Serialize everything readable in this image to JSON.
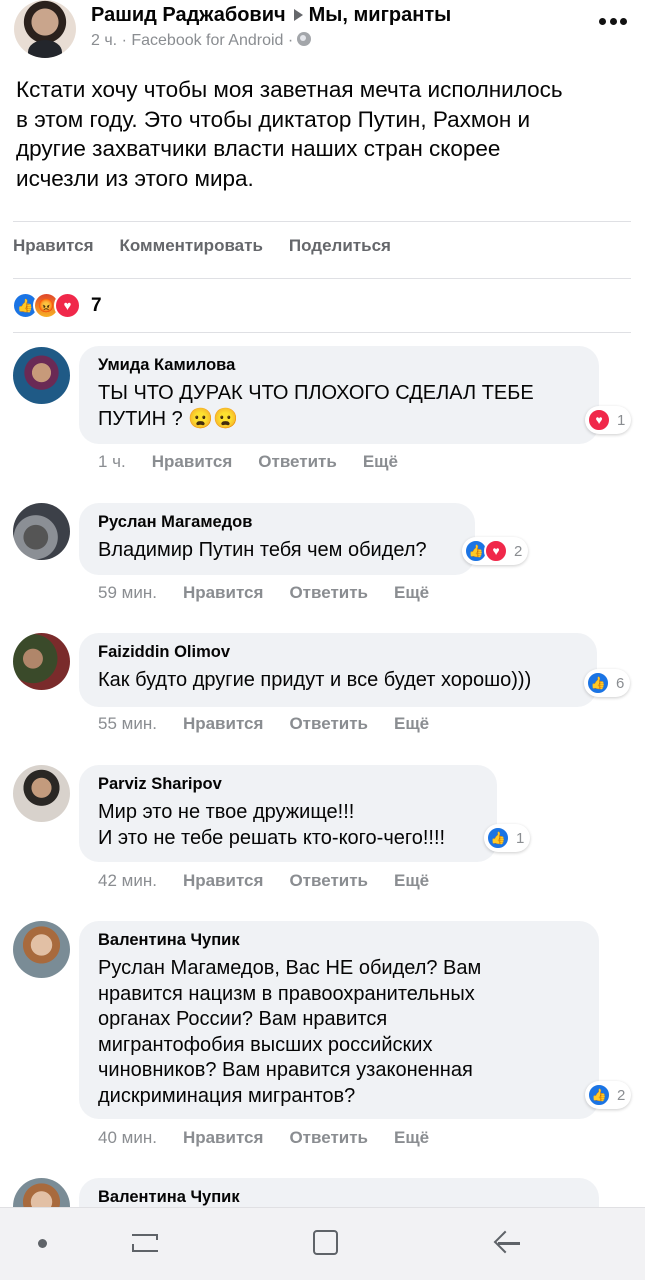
{
  "post": {
    "author": "Рашид Раджабович",
    "group": "Мы, мигранты",
    "time": "2 ч.",
    "source": "Facebook for Android",
    "text": "Кстати хочу чтобы моя заветная мечта исполнилось\nв этом году. Это чтобы диктатор Путин, Рахмон и\nдругие захватчики власти наших стран скорее\nисчезли из этого мира.",
    "actions": {
      "like": "Нравится",
      "comment": "Комментировать",
      "share": "Поделиться"
    },
    "reactions": [
      "like",
      "angry",
      "love"
    ],
    "reaction_count": "7"
  },
  "comment_actions": {
    "like": "Нравится",
    "reply": "Ответить",
    "more": "Ещё"
  },
  "comments": [
    {
      "name": "Умида Камилова",
      "text": "ТЫ ЧТО ДУРАК ЧТО ПЛОХОГО СДЕЛАЛ ТЕБЕ\nПУТИН ? 😦😦",
      "time": "1 ч.",
      "reactions": [
        "love"
      ],
      "count": "1"
    },
    {
      "name": "Руслан Магамедов",
      "text": "Владимир Путин тебя чем обидел?",
      "time": "59 мин.",
      "reactions": [
        "like",
        "love"
      ],
      "count": "2"
    },
    {
      "name": "Faiziddin Olimov",
      "text": "Как будто другие придут и все будет хорошо)))",
      "time": "55 мин.",
      "reactions": [
        "like"
      ],
      "count": "6"
    },
    {
      "name": "Parviz Sharipov",
      "text": "Мир это не твое дружище!!!\nИ это не тебе решать кто-кого-чего!!!!",
      "time": "42 мин.",
      "reactions": [
        "like"
      ],
      "count": "1"
    },
    {
      "name": "Валентина Чупик",
      "text": "Руслан Магамедов, Вас НЕ обидел? Вам\nнравится нацизм в правоохранительных\nорганах России? Вам нравится\nмигрантофобия высших российских\nчиновников? Вам нравится узаконенная\nдискриминация мигрантов?",
      "time": "40 мин.",
      "reactions": [
        "like"
      ],
      "count": "2"
    },
    {
      "name": "Валентина Чупик",
      "text": "",
      "time": "",
      "reactions": [],
      "count": ""
    }
  ],
  "colors": {
    "like": "#1b74e4",
    "love": "#f0284a",
    "angry": "#f7b125",
    "bubble": "#f0f2f5",
    "muted": "#8a8d91"
  }
}
